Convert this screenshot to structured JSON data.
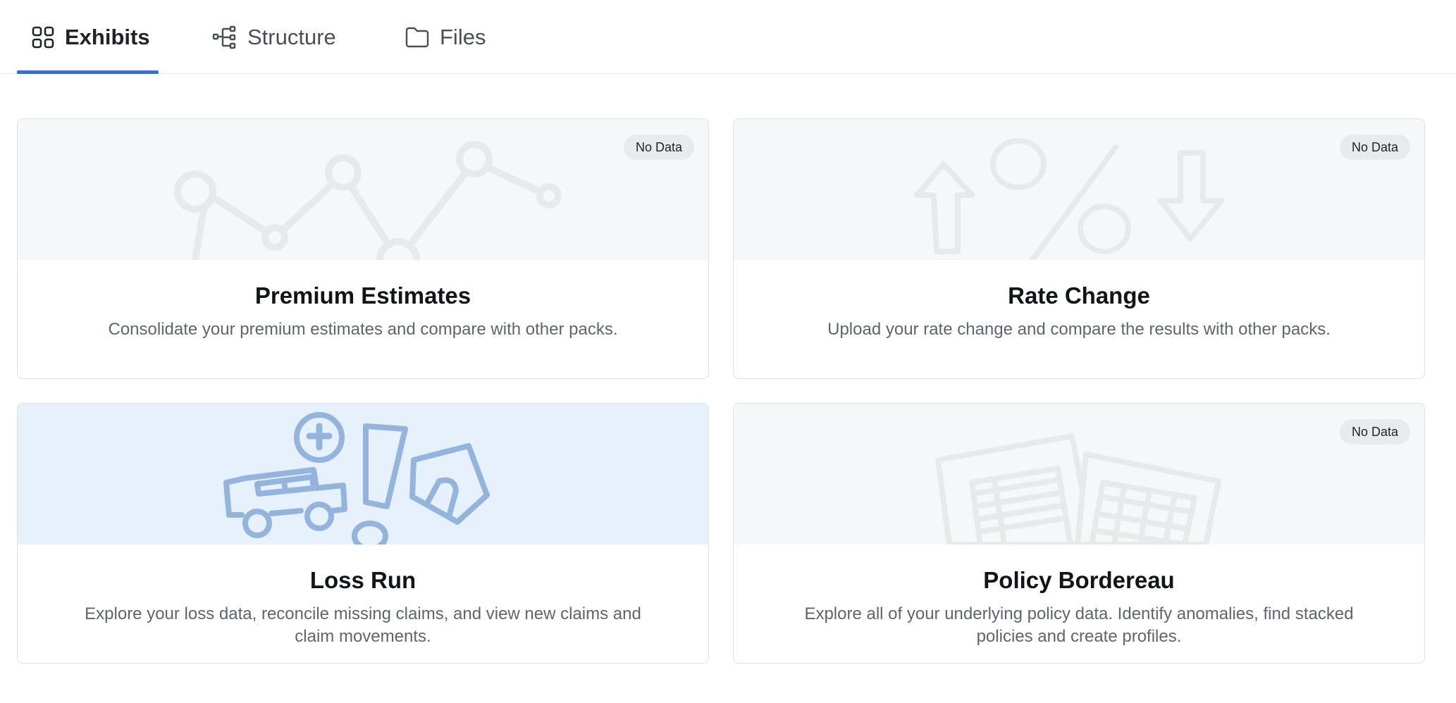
{
  "tabs": [
    {
      "label": "Exhibits",
      "icon": "grid-icon",
      "active": true
    },
    {
      "label": "Structure",
      "icon": "hierarchy-icon",
      "active": false
    },
    {
      "label": "Files",
      "icon": "folder-icon",
      "active": false
    }
  ],
  "colors": {
    "accent": "#2f6fd6",
    "banner_idle": "#f6f7f9",
    "banner_active": "#e7f1fb",
    "illustration_idle": "#e8e9eb",
    "illustration_active": "#93b4dc"
  },
  "cards": [
    {
      "title": "Premium Estimates",
      "description": "Consolidate your premium estimates and compare with other packs.",
      "badge": "No Data",
      "illustration": "line-chart-icon"
    },
    {
      "title": "Rate Change",
      "description": "Upload your rate change and compare the results with other packs.",
      "badge": "No Data",
      "illustration": "percent-arrows-icon"
    },
    {
      "title": "Loss Run",
      "description": "Explore your loss data, reconcile missing claims, and view new claims and claim movements.",
      "badge": "",
      "illustration": "car-house-medical-icon"
    },
    {
      "title": "Policy Bordereau",
      "description": "Explore all of your underlying policy data. Identify anomalies, find stacked policies and create profiles.",
      "badge": "No Data",
      "illustration": "spreadsheets-icon"
    }
  ]
}
